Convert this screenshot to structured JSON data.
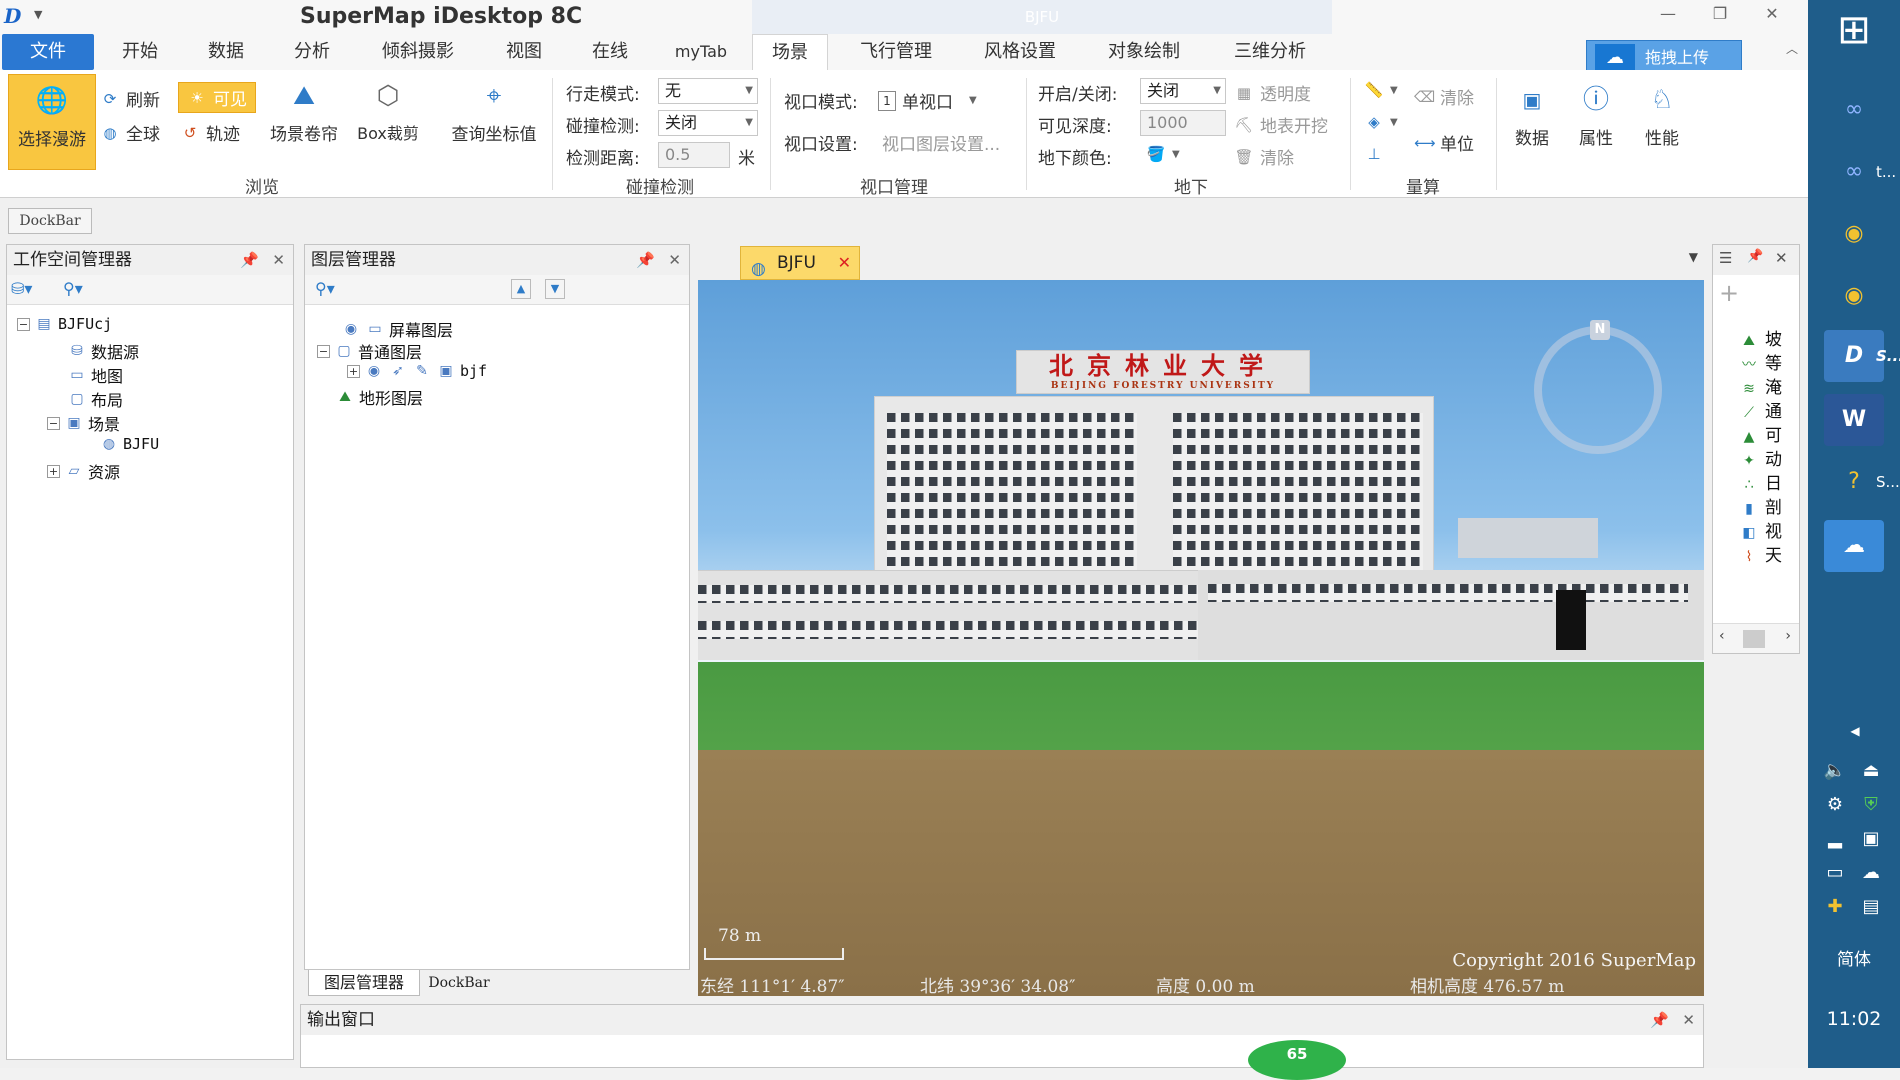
{
  "app": {
    "title": "SuperMap iDesktop 8C",
    "doc_title": "BJFU"
  },
  "ribbon_tabs": [
    {
      "label": "文件"
    },
    {
      "label": "开始"
    },
    {
      "label": "数据"
    },
    {
      "label": "分析"
    },
    {
      "label": "倾斜摄影"
    },
    {
      "label": "视图"
    },
    {
      "label": "在线"
    },
    {
      "label": "myTab"
    },
    {
      "label": "场景"
    },
    {
      "label": "飞行管理"
    },
    {
      "label": "风格设置"
    },
    {
      "label": "对象绘制"
    },
    {
      "label": "三维分析"
    }
  ],
  "upload_label": "拖拽上传",
  "ribbon": {
    "browse": {
      "group": "浏览",
      "select_roam": "选择漫游",
      "refresh": "刷新",
      "visible": "可见",
      "globe": "全球",
      "track": "轨迹",
      "scene_roll": "场景卷帘",
      "box_clip": "Box裁剪",
      "query_coord": "查询坐标值"
    },
    "collision": {
      "group": "碰撞检测",
      "walk_mode_label": "行走模式:",
      "walk_mode_value": "无",
      "collision_label": "碰撞检测:",
      "collision_value": "关闭",
      "distance_label": "检测距离:",
      "distance_value": "0.5",
      "distance_unit": "米"
    },
    "viewport": {
      "group": "视口管理",
      "mode_label": "视口模式:",
      "mode_value": "单视口",
      "mode_index": "1",
      "settings_label": "视口设置:",
      "settings_value": "视口图层设置..."
    },
    "underground": {
      "group": "地下",
      "toggle_label": "开启/关闭:",
      "toggle_value": "关闭",
      "transparency": "透明度",
      "depth_label": "可见深度:",
      "depth_value": "1000",
      "excavate": "地表开挖",
      "color_label": "地下颜色:",
      "clear": "清除"
    },
    "measure": {
      "group": "量算",
      "clear": "清除",
      "unit": "单位"
    },
    "data": "数据",
    "properties": "属性",
    "performance": "性能"
  },
  "dockbar_label": "DockBar",
  "workspace": {
    "title": "工作空间管理器",
    "items": [
      {
        "label": "BJFUcj"
      },
      {
        "label": "数据源"
      },
      {
        "label": "地图"
      },
      {
        "label": "布局"
      },
      {
        "label": "场景"
      },
      {
        "label": "BJFU"
      },
      {
        "label": "资源"
      }
    ]
  },
  "layers": {
    "title": "图层管理器",
    "items": [
      {
        "label": "屏幕图层"
      },
      {
        "label": "普通图层"
      },
      {
        "label": "bjf"
      },
      {
        "label": "地形图层"
      }
    ],
    "bottom_tabs": [
      {
        "label": "图层管理器"
      },
      {
        "label": "DockBar"
      }
    ]
  },
  "scene": {
    "tab": "BJFU",
    "sign_cn": "北京林业大学",
    "sign_en": "BEIJING FORESTRY UNIVERSITY",
    "compass": "N",
    "scale": "78 m",
    "copyright": "Copyright 2016 SuperMap",
    "lon": "东经 111°1′ 4.87″",
    "lat": "北纬 39°36′ 34.08″",
    "alt": "高度 0.00 m",
    "cam": "相机高度 476.57 m"
  },
  "right_panel": {
    "items": [
      {
        "label": "坡"
      },
      {
        "label": "等"
      },
      {
        "label": "淹"
      },
      {
        "label": "通"
      },
      {
        "label": "可"
      },
      {
        "label": "动"
      },
      {
        "label": "日"
      },
      {
        "label": "剖"
      },
      {
        "label": "视"
      },
      {
        "label": "天"
      }
    ]
  },
  "output": {
    "title": "输出窗口",
    "progress": "65"
  },
  "taskbar": {
    "items": [
      {
        "label": "t..."
      },
      {
        "label": "S..."
      },
      {
        "label": "S..."
      }
    ],
    "ime": "简体",
    "clock": "11:02"
  },
  "colors": {
    "accent": "#2b78d2",
    "selected": "#f9c640",
    "taskbar": "#1f5d8a"
  }
}
